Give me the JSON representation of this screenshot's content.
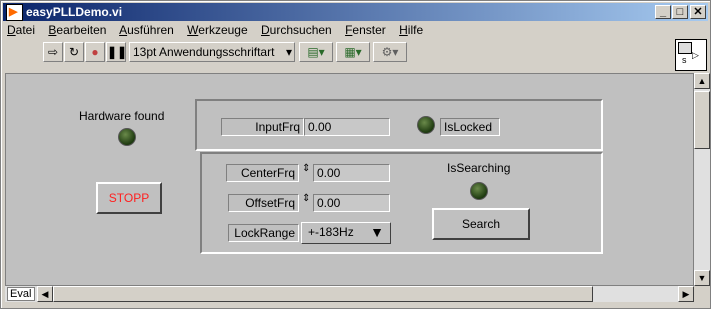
{
  "window": {
    "title": "easyPLLDemo.vi"
  },
  "menu": [
    {
      "pre": "",
      "ul": "D",
      "post": "atei"
    },
    {
      "pre": "",
      "ul": "B",
      "post": "earbeiten"
    },
    {
      "pre": "",
      "ul": "A",
      "post": "usführen"
    },
    {
      "pre": "",
      "ul": "W",
      "post": "erkzeuge"
    },
    {
      "pre": "",
      "ul": "D",
      "post": "urchsuchen"
    },
    {
      "pre": "",
      "ul": "F",
      "post": "enster"
    },
    {
      "pre": "",
      "ul": "H",
      "post": "ilfe"
    }
  ],
  "toolbar": {
    "font": "13pt Anwendungsschriftart"
  },
  "front_panel": {
    "hardware_found": "Hardware found",
    "stopp": "STOPP",
    "input_frq_label": "InputFrq",
    "input_frq_value": "0.00",
    "is_locked": "IsLocked",
    "center_frq_label": "CenterFrq",
    "center_frq_value": "0.00",
    "offset_frq_label": "OffsetFrq",
    "offset_frq_value": "0.00",
    "lock_range_label": "LockRange",
    "lock_range_value": "+-183Hz",
    "is_searching": "IsSearching",
    "search": "Search"
  },
  "scrollbar": {
    "mode": "Eval"
  },
  "colors": {
    "stopp_text": "#ff2020",
    "led_off": "#2a4a1a"
  }
}
